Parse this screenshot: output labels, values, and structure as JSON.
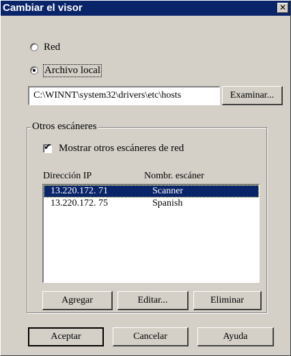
{
  "window": {
    "title": "Cambiar el visor",
    "close_glyph": "✕"
  },
  "source": {
    "options": [
      {
        "label": "Red",
        "checked": false
      },
      {
        "label": "Archivo local",
        "checked": true
      }
    ],
    "path_value": "C:\\WINNT\\system32\\drivers\\etc\\hosts",
    "browse_label": "Examinar..."
  },
  "scanners_group": {
    "label": "Otros escáneres",
    "show_checkbox": {
      "label": "Mostrar otros escáneres de red",
      "checked": true
    },
    "columns": [
      "Dirección IP",
      "Nombr. escáner"
    ],
    "rows": [
      {
        "ip": "13.220.172. 71",
        "name": "Scanner",
        "selected": true
      },
      {
        "ip": "13.220.172. 75",
        "name": "Spanish",
        "selected": false
      }
    ],
    "buttons": {
      "add": "Agregar",
      "edit": "Editar...",
      "delete": "Eliminar"
    }
  },
  "footer": {
    "ok": "Aceptar",
    "cancel": "Cancelar",
    "help": "Ayuda"
  },
  "colors": {
    "face": "#d4d0c8",
    "titlebar": "#0a246a",
    "selection": "#0a246a"
  },
  "icons": {
    "close": "close-icon",
    "check": "checkmark-icon"
  }
}
